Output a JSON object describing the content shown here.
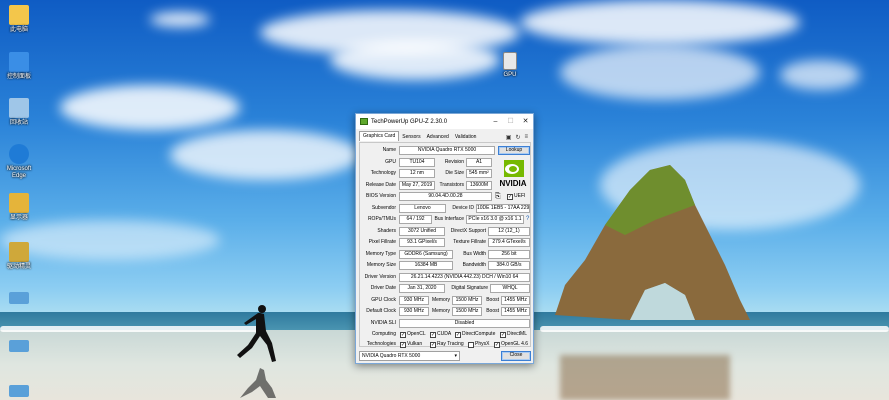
{
  "desktop": {
    "icons": [
      {
        "label": "此电脑",
        "color": "#f3c64b"
      },
      {
        "label": "控制面板",
        "color": "#3a8ee6"
      },
      {
        "label": "回收站",
        "color": "#9fc6e8"
      },
      {
        "label": "Microsoft\nEdge",
        "color": "#1f7bd6"
      },
      {
        "label": "显示器",
        "color": "#e5b43a"
      },
      {
        "label": "驱动精灵",
        "color": "#cfa83a"
      },
      {
        "label": "",
        "color": "#5aa0d9"
      },
      {
        "label": "",
        "color": "#5aa0d9"
      },
      {
        "label": "",
        "color": "#5aa0d9"
      }
    ],
    "file_icon": {
      "label": "GPU"
    }
  },
  "window": {
    "title": "TechPowerUp GPU-Z 2.30.0",
    "controls": {
      "minimize": "–",
      "maximize": "☐",
      "close": "✕"
    },
    "tabs": [
      "Graphics Card",
      "Sensors",
      "Advanced",
      "Validation"
    ],
    "tab_icons": [
      "camera-icon",
      "refresh-icon",
      "menu-icon"
    ],
    "fields": {
      "name_label": "Name",
      "name": "NVIDIA Quadro RTX 5000",
      "lookup": "Lookup",
      "gpu_label": "GPU",
      "gpu": "TU104",
      "revision_label": "Revision",
      "revision": "A1",
      "technology_label": "Technology",
      "technology": "12 nm",
      "die_size_label": "Die Size",
      "die_size": "545 mm²",
      "release_date_label": "Release Date",
      "release_date": "May 27, 2019",
      "transistors_label": "Transistors",
      "transistors": "13600M",
      "bios_label": "BIOS Version",
      "bios": "90.04.4D.00.28",
      "uefi": "UEFI",
      "subvendor_label": "Subvendor",
      "subvendor": "Lenovo",
      "device_id_label": "Device ID",
      "device_id": "10DE 1EB5 - 17AA 229B",
      "rops_label": "ROPs/TMUs",
      "rops": "64 / 192",
      "bus_interface_label": "Bus Interface",
      "bus_interface": "PCIe x16 3.0 @ x16 1.1",
      "help": "?",
      "shaders_label": "Shaders",
      "shaders": "3072 Unified",
      "directx_label": "DirectX Support",
      "directx": "12 (12_1)",
      "pixel_fillrate_label": "Pixel Fillrate",
      "pixel_fillrate": "93.1 GPixel/s",
      "texture_fillrate_label": "Texture Fillrate",
      "texture_fillrate": "279.4 GTexel/s",
      "memory_type_label": "Memory Type",
      "memory_type": "GDDR6 (Samsung)",
      "bus_width_label": "Bus Width",
      "bus_width": "256 bit",
      "memory_size_label": "Memory Size",
      "memory_size": "16384 MB",
      "bandwidth_label": "Bandwidth",
      "bandwidth": "384.0 GB/s",
      "driver_version_label": "Driver Version",
      "driver_version": "26.21.14.4223 (NVIDIA 442.23) DCH / Win10 64",
      "driver_date_label": "Driver Date",
      "driver_date": "Jan 31, 2020",
      "digital_signature_label": "Digital Signature",
      "digital_signature": "WHQL",
      "gpu_clock_label": "GPU Clock",
      "gpu_clock": "930 MHz",
      "memory_label": "Memory",
      "memory_clock": "1500 MHz",
      "boost_label": "Boost",
      "boost_clock": "1455 MHz",
      "default_clock_label": "Default Clock",
      "default_clock": "930 MHz",
      "default_memory": "1500 MHz",
      "default_boost": "1455 MHz",
      "sli_label": "NVIDIA SLI",
      "sli": "Disabled",
      "computing_label": "Computing",
      "technologies_label": "Technologies"
    },
    "computing": [
      "OpenCL",
      "CUDA",
      "DirectCompute",
      "DirectML"
    ],
    "technologies": [
      {
        "name": "Vulkan",
        "checked": true
      },
      {
        "name": "Ray Tracing",
        "checked": true
      },
      {
        "name": "PhysX",
        "checked": false
      },
      {
        "name": "OpenGL 4.6",
        "checked": true
      }
    ],
    "logo_text": "NVIDIA",
    "selected_card": "NVIDIA Quadro RTX 5000",
    "close_button": "Close"
  }
}
